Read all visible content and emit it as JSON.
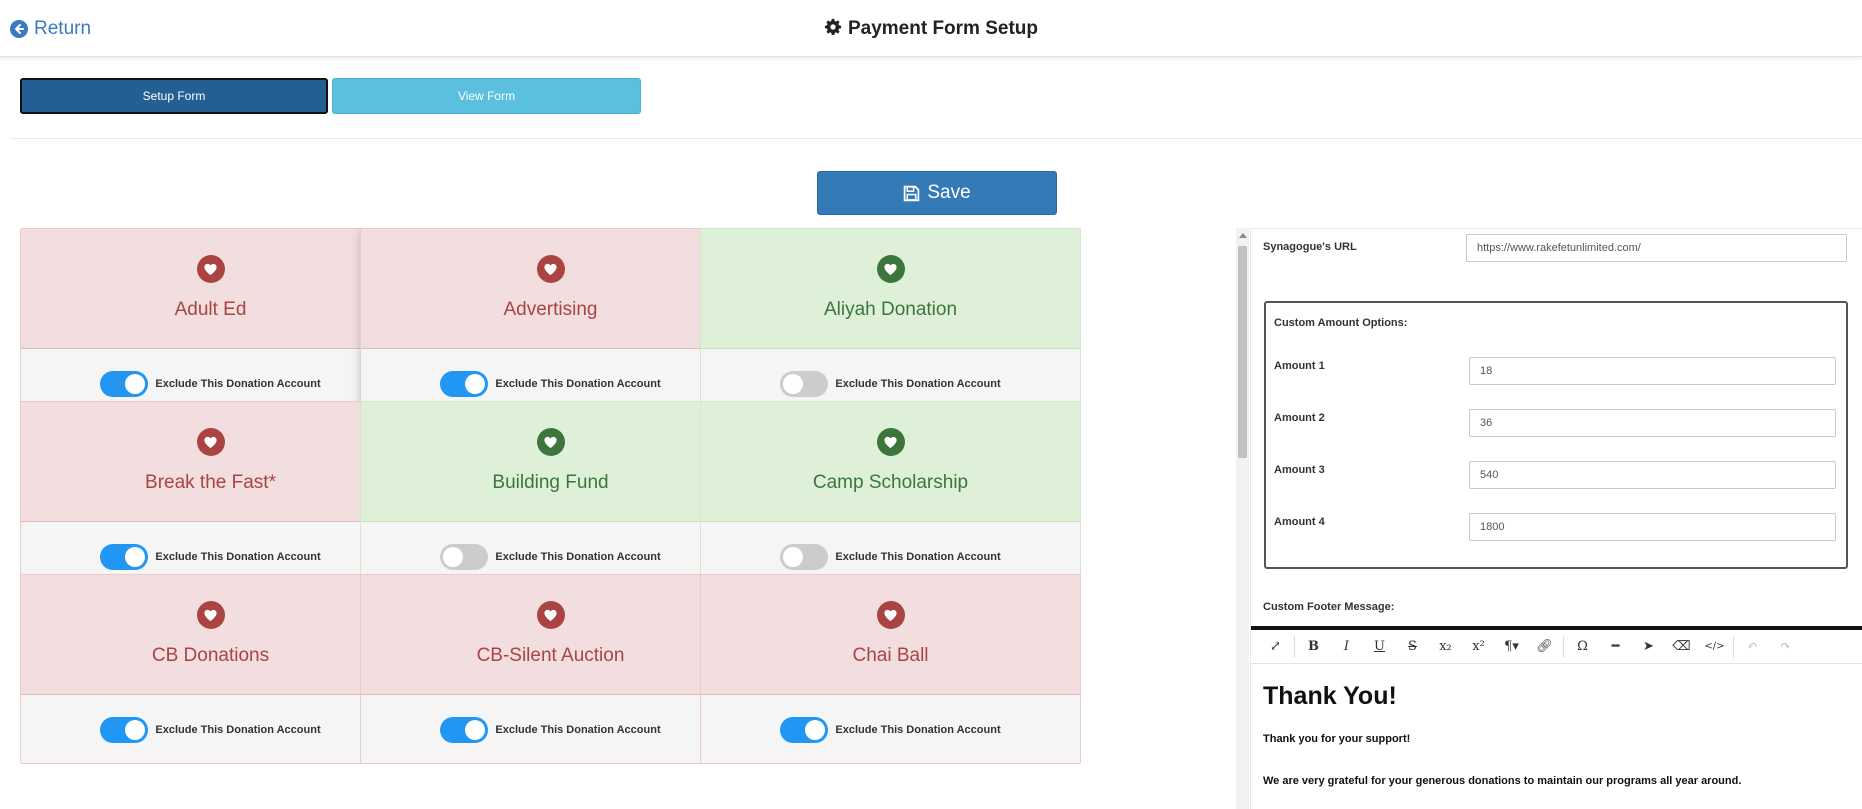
{
  "header": {
    "return_label": "Return",
    "title": "Payment Form Setup"
  },
  "tabs": [
    {
      "label": "Setup Form",
      "active": true
    },
    {
      "label": "View Form",
      "active": false
    }
  ],
  "save_label": "Save",
  "accounts": [
    {
      "name": "Adult Ed",
      "status": "excluded",
      "toggle_on": true,
      "toggle_label": "Exclude This Donation Account"
    },
    {
      "name": "Advertising",
      "status": "excluded",
      "toggle_on": true,
      "toggle_label": "Exclude This Donation Account"
    },
    {
      "name": "Aliyah Donation",
      "status": "included",
      "toggle_on": false,
      "toggle_label": "Exclude This Donation Account"
    },
    {
      "name": "Break the Fast*",
      "status": "excluded",
      "toggle_on": true,
      "toggle_label": "Exclude This Donation Account"
    },
    {
      "name": "Building Fund",
      "status": "included",
      "toggle_on": false,
      "toggle_label": "Exclude This Donation Account"
    },
    {
      "name": "Camp Scholarship",
      "status": "included",
      "toggle_on": false,
      "toggle_label": "Exclude This Donation Account"
    },
    {
      "name": "CB Donations",
      "status": "excluded",
      "toggle_on": true,
      "toggle_label": "Exclude This Donation Account"
    },
    {
      "name": "CB-Silent Auction",
      "status": "excluded",
      "toggle_on": true,
      "toggle_label": "Exclude This Donation Account"
    },
    {
      "name": "Chai Ball",
      "status": "excluded",
      "toggle_on": true,
      "toggle_label": "Exclude This Donation Account"
    }
  ],
  "colors": {
    "excluded_bg": "#f2dede",
    "excluded_text": "#a94442",
    "included_bg": "#dff0d8",
    "included_text": "#3c763d",
    "toggle_on": "#2196f3",
    "primary": "#337ab7"
  },
  "settings": {
    "url_label": "Synagogue's URL",
    "url_value": "https://www.rakefetunlimited.com/",
    "amounts_title": "Custom Amount Options:",
    "amounts": [
      {
        "label": "Amount 1",
        "value": "18"
      },
      {
        "label": "Amount 2",
        "value": "36"
      },
      {
        "label": "Amount 3",
        "value": "540"
      },
      {
        "label": "Amount 4",
        "value": "1800"
      }
    ],
    "footer_label": "Custom Footer Message:"
  },
  "editor": {
    "toolbar": [
      "expand-icon",
      "bold-icon",
      "italic-icon",
      "underline-icon",
      "strikethrough-icon",
      "subscript-icon",
      "superscript-icon",
      "paragraph-icon",
      "link-icon",
      "omega-icon",
      "horizontal-rule-icon",
      "pointer-icon",
      "eraser-icon",
      "code-view-icon",
      "undo-icon",
      "redo-icon"
    ],
    "heading": "Thank You!",
    "line1": "Thank you for your support!",
    "line2": "We are very grateful for your generous donations to maintain our programs all year around."
  }
}
